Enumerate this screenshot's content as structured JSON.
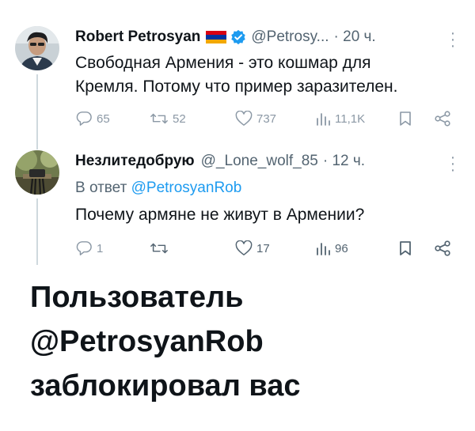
{
  "tweet1": {
    "author_name": "Robert Petrosyan",
    "handle": "@Petrosy...",
    "time": "· 20 ч.",
    "text_line1": "Свободная Армения - это кошмар для",
    "text_line2": "Кремля. Потому что пример заразителен.",
    "replies": "65",
    "retweets": "52",
    "likes": "737",
    "views": "11,1K",
    "more_icon": "more-dots-icon"
  },
  "tweet2": {
    "author_name": "Незлитедобрую",
    "handle": "@_Lone_wolf_85",
    "time": "· 12 ч.",
    "reply_prefix": "В ответ",
    "reply_to": "@PetrosyanRob",
    "text": "Почему армяне не живут в Армении?",
    "replies": "1",
    "retweets": "",
    "likes": "17",
    "views": "96"
  },
  "blocked_notice": {
    "line1": "Пользователь",
    "line2": "@PetrosyanRob",
    "line3": "заблокировал вас"
  },
  "colors": {
    "text": "#0f1419",
    "muted": "#536471",
    "link": "#1d9bf0",
    "icon": "#8b98a5",
    "verified": "#1d9bf0",
    "flag_red": "#d90012",
    "flag_blue": "#0033a0",
    "flag_orange": "#f2a800"
  }
}
